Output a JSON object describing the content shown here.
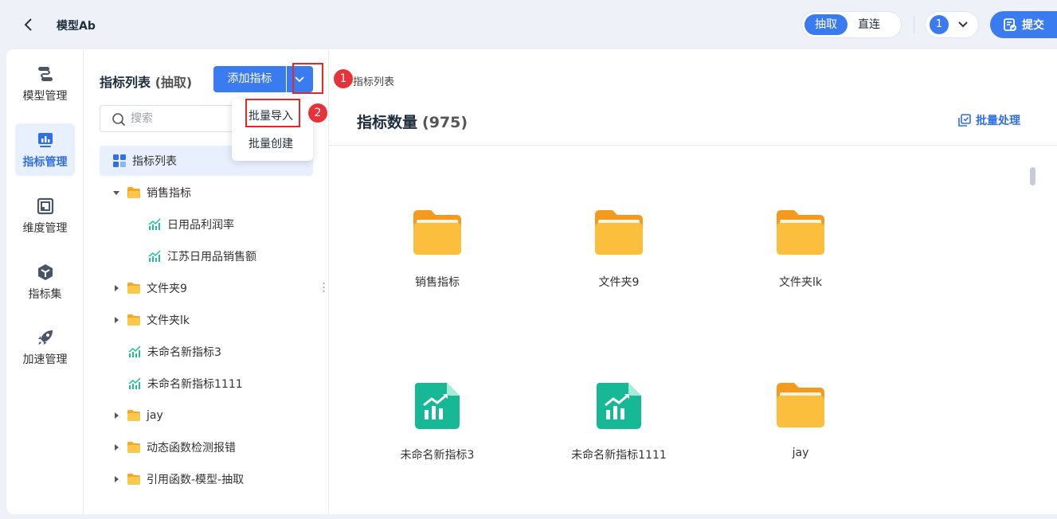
{
  "header": {
    "model_title": "模型Ab",
    "mode_extract": "抽取",
    "mode_direct": "直连",
    "user_badge": "1",
    "submit_label": "提交"
  },
  "nav": [
    {
      "label": "模型管理",
      "icon": "model-flow-icon"
    },
    {
      "label": "指标管理",
      "icon": "metric-chart-icon"
    },
    {
      "label": "维度管理",
      "icon": "dimension-icon"
    },
    {
      "label": "指标集",
      "icon": "metric-set-icon"
    },
    {
      "label": "加速管理",
      "icon": "rocket-icon"
    }
  ],
  "tree": {
    "title": "指标列表",
    "title_suffix": "(抽取)",
    "add_label": "添加指标",
    "search_placeholder": "搜索",
    "items": [
      {
        "label": "指标列表",
        "kind": "grid"
      },
      {
        "label": "销售指标",
        "kind": "folder-open"
      },
      {
        "label": "日用品利润率",
        "kind": "metric"
      },
      {
        "label": "江苏日用品销售额",
        "kind": "metric"
      },
      {
        "label": "文件夹9",
        "kind": "folder"
      },
      {
        "label": "文件夹lk",
        "kind": "folder"
      },
      {
        "label": "未命名新指标3",
        "kind": "metric"
      },
      {
        "label": "未命名新指标1111",
        "kind": "metric"
      },
      {
        "label": "jay",
        "kind": "folder"
      },
      {
        "label": "动态函数检测报错",
        "kind": "folder"
      },
      {
        "label": "引用函数-模型-抽取",
        "kind": "folder"
      }
    ]
  },
  "dropdown": {
    "items": [
      "批量导入",
      "批量创建"
    ],
    "badge1": "1",
    "badge2": "2"
  },
  "content": {
    "breadcrumb": "指标列表",
    "title": "指标数量",
    "count": "(975)",
    "batch_label": "批量处理",
    "tiles": [
      {
        "label": "销售指标",
        "kind": "folder"
      },
      {
        "label": "文件夹9",
        "kind": "folder"
      },
      {
        "label": "文件夹lk",
        "kind": "folder"
      },
      {
        "label": "未命名新指标3",
        "kind": "metric"
      },
      {
        "label": "未命名新指标1111",
        "kind": "metric"
      },
      {
        "label": "jay",
        "kind": "folder"
      }
    ]
  },
  "colors": {
    "primary": "#3b7bf0",
    "folder": "#f8b432",
    "metric": "#1fbf9f",
    "highlight": "#e0282e"
  }
}
